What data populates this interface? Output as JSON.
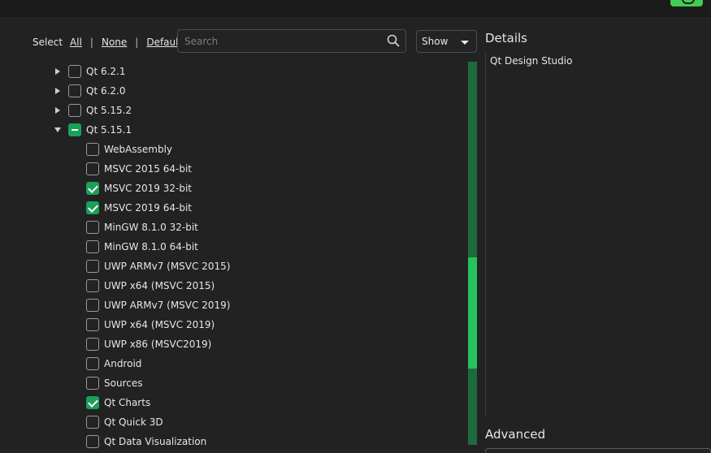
{
  "filter": {
    "select_label": "Select",
    "all_label": "All",
    "none_label": "None",
    "default_label": "Default",
    "separator": "|"
  },
  "search": {
    "placeholder": "Search"
  },
  "show_select": {
    "value": "Show"
  },
  "tree": {
    "top_items": [
      {
        "label": "Qt 6.2.1",
        "state": "unchecked",
        "expanded": false
      },
      {
        "label": "Qt 6.2.0",
        "state": "unchecked",
        "expanded": false
      },
      {
        "label": "Qt 5.15.2",
        "state": "unchecked",
        "expanded": false
      },
      {
        "label": "Qt 5.15.1",
        "state": "partial",
        "expanded": true
      }
    ],
    "children": [
      {
        "label": "WebAssembly",
        "checked": false
      },
      {
        "label": "MSVC 2015 64-bit",
        "checked": false
      },
      {
        "label": "MSVC 2019 32-bit",
        "checked": true
      },
      {
        "label": "MSVC 2019 64-bit",
        "checked": true
      },
      {
        "label": "MinGW 8.1.0 32-bit",
        "checked": false
      },
      {
        "label": "MinGW 8.1.0 64-bit",
        "checked": false
      },
      {
        "label": "UWP ARMv7 (MSVC 2015)",
        "checked": false
      },
      {
        "label": "UWP x64 (MSVC 2015)",
        "checked": false
      },
      {
        "label": "UWP ARMv7 (MSVC 2019)",
        "checked": false
      },
      {
        "label": "UWP x64 (MSVC 2019)",
        "checked": false
      },
      {
        "label": "UWP x86 (MSVC2019)",
        "checked": false
      },
      {
        "label": "Android",
        "checked": false
      },
      {
        "label": "Sources",
        "checked": false
      },
      {
        "label": "Qt Charts",
        "checked": true
      },
      {
        "label": "Qt Quick 3D",
        "checked": false
      },
      {
        "label": "Qt Data Visualization",
        "checked": false
      }
    ]
  },
  "details": {
    "title": "Details",
    "text": "Qt Design Studio"
  },
  "advanced": {
    "title": "Advanced"
  },
  "colors": {
    "accent": "#41cd52",
    "checkbox_checked": "#1aa058",
    "scrollbar_track": "#1d6b3d",
    "scrollbar_thumb": "#26c25e"
  }
}
